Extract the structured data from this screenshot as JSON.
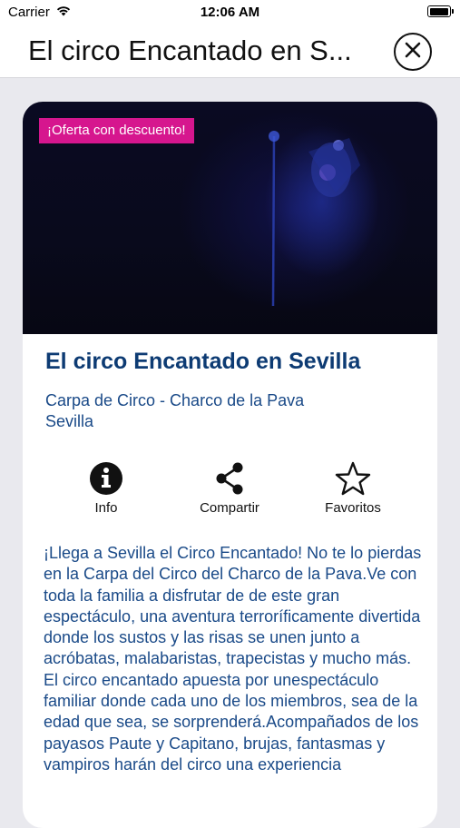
{
  "status_bar": {
    "carrier": "Carrier",
    "time": "12:06 AM"
  },
  "nav": {
    "title": "El circo Encantado en S..."
  },
  "event": {
    "badge": "¡Oferta con descuento!",
    "title": "El circo Encantado en Sevilla",
    "venue_line1": "Carpa de Circo - Charco de la Pava",
    "venue_line2": "Sevilla",
    "actions": [
      {
        "label": "Info",
        "icon": "info-icon"
      },
      {
        "label": "Compartir",
        "icon": "share-icon"
      },
      {
        "label": "Favoritos",
        "icon": "star-icon"
      }
    ],
    "description": "¡Llega a Sevilla el Circo Encantado! No te lo pierdas en la Carpa del Circo del Charco de la Pava.Ve con toda la familia a disfrutar de de este gran espectáculo, una aventura terroríficamente divertida donde los sustos y las risas se unen junto a acróbatas, malabaristas, trapecistas y mucho más. El circo encantado apuesta por unespectáculo familiar donde cada uno de los miembros, sea de la edad que sea, se sorprenderá.Acompañados de los payasos Paute y Capitano, brujas, fantasmas y vampiros harán del circo una experiencia"
  }
}
